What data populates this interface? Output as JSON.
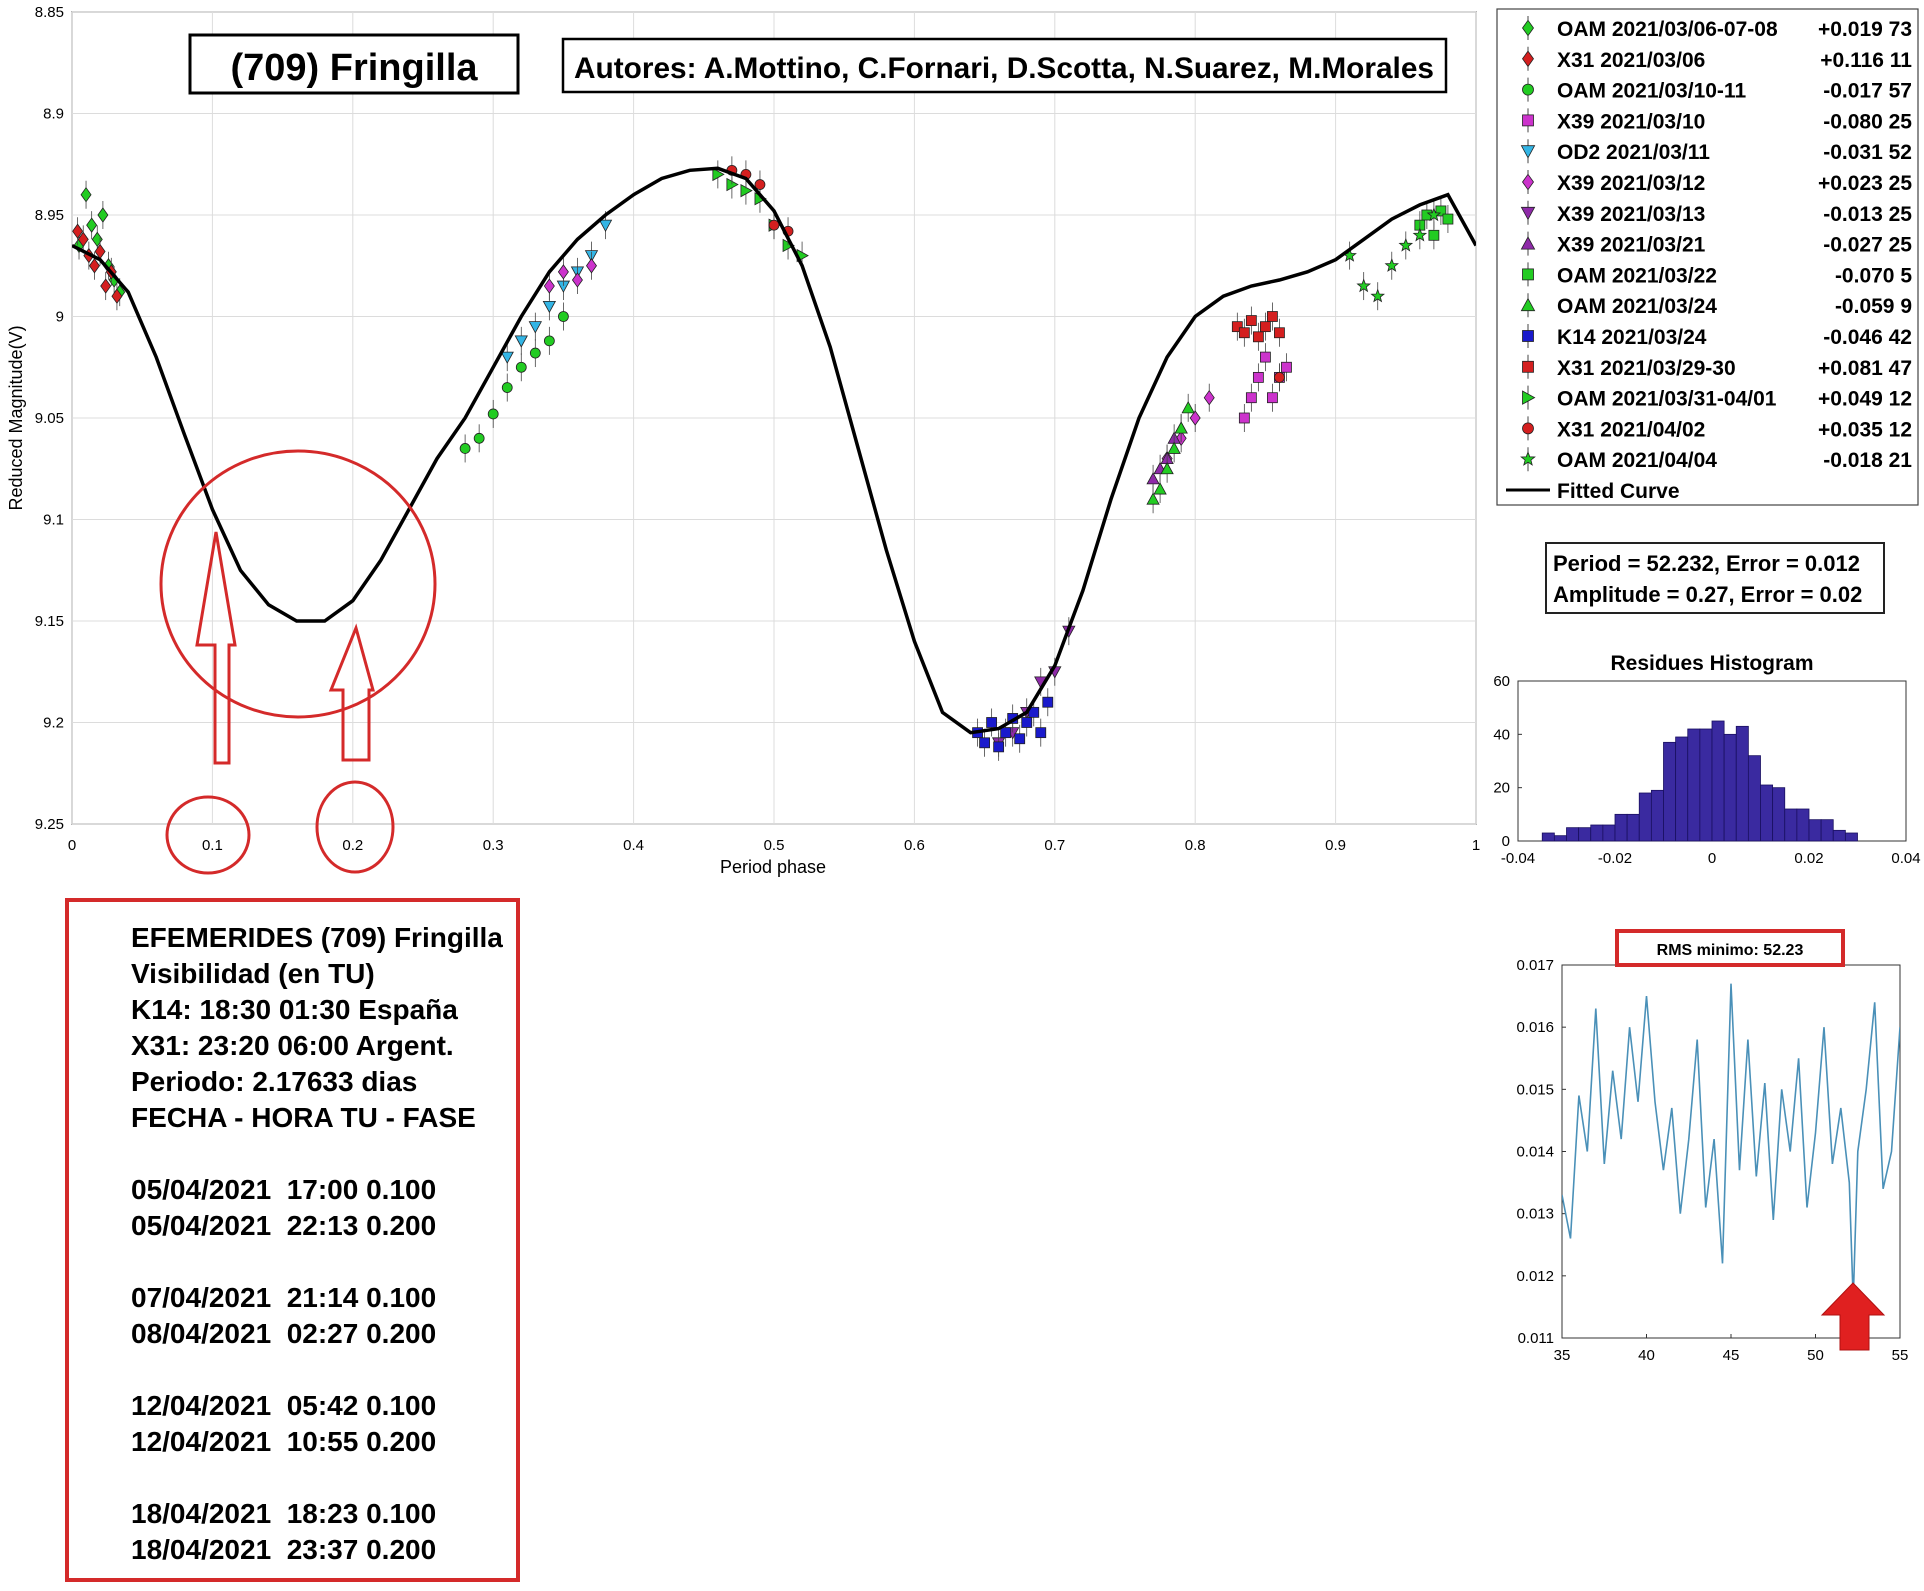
{
  "colors": {
    "green": "#22cc22",
    "red": "#d41f1f",
    "magenta": "#cc33cc",
    "purple": "#8e2aa8",
    "cyan": "#33b5e5",
    "blue": "#1a1acc",
    "annotation_red": "#d42a2a",
    "histogram_bar": "#3a2aa0",
    "rms_line": "#4a90b8"
  },
  "header": {
    "object_title": "(709) Fringilla",
    "authors": "Autores: A.Mottino, C.Fornari, D.Scotta, N.Suarez, M.Morales"
  },
  "stats": {
    "period_line": "Period =  52.232, Error = 0.012",
    "amplitude_line": "Amplitude = 0.27, Error = 0.02"
  },
  "legend": {
    "entries": [
      {
        "label": "OAM 2021/03/06-07-08",
        "value": "+0.019 73",
        "marker": "diamond",
        "color": "#22cc22"
      },
      {
        "label": "X31 2021/03/06",
        "value": "+0.116 11",
        "marker": "diamond",
        "color": "#d41f1f"
      },
      {
        "label": "OAM 2021/03/10-11",
        "value": "-0.017 57",
        "marker": "circle",
        "color": "#22cc22"
      },
      {
        "label": "X39 2021/03/10",
        "value": "-0.080 25",
        "marker": "square",
        "color": "#cc33cc"
      },
      {
        "label": "OD2 2021/03/11",
        "value": "-0.031 52",
        "marker": "triangle-down",
        "color": "#33b5e5"
      },
      {
        "label": "X39 2021/03/12",
        "value": "+0.023 25",
        "marker": "diamond",
        "color": "#cc33cc"
      },
      {
        "label": "X39 2021/03/13",
        "value": "-0.013 25",
        "marker": "triangle-down",
        "color": "#8e2aa8"
      },
      {
        "label": "X39 2021/03/21",
        "value": "-0.027 25",
        "marker": "triangle-up",
        "color": "#8e2aa8"
      },
      {
        "label": "OAM 2021/03/22",
        "value": "-0.070  5",
        "marker": "square",
        "color": "#22cc22"
      },
      {
        "label": "OAM 2021/03/24",
        "value": "-0.059  9",
        "marker": "triangle-up",
        "color": "#22cc22"
      },
      {
        "label": "K14 2021/03/24",
        "value": "-0.046 42",
        "marker": "square",
        "color": "#1a1acc"
      },
      {
        "label": "X31 2021/03/29-30",
        "value": "+0.081 47",
        "marker": "square",
        "color": "#d41f1f"
      },
      {
        "label": "OAM 2021/03/31-04/01",
        "value": "+0.049 12",
        "marker": "triangle-right",
        "color": "#22cc22"
      },
      {
        "label": "X31 2021/04/02",
        "value": "+0.035 12",
        "marker": "circle",
        "color": "#d41f1f"
      },
      {
        "label": "OAM 2021/04/04",
        "value": "-0.018 21",
        "marker": "star",
        "color": "#22cc22"
      },
      {
        "label": "Fitted Curve",
        "value": "",
        "marker": "line",
        "color": "#000000"
      }
    ]
  },
  "ephemeris": {
    "lines": [
      "EFEMERIDES (709) Fringilla",
      "Visibilidad (en TU)",
      "K14: 18:30 01:30 España",
      "X31: 23:20 06:00 Argent.",
      "Periodo: 2.17633 dias",
      "FECHA - HORA TU - FASE",
      "",
      "05/04/2021  17:00 0.100",
      "05/04/2021  22:13 0.200",
      "",
      "07/04/2021  21:14 0.100",
      "08/04/2021  02:27 0.200",
      "",
      "12/04/2021  05:42 0.100",
      "12/04/2021  10:55 0.200",
      "",
      "18/04/2021  18:23 0.100",
      "18/04/2021  23:37 0.200"
    ]
  },
  "rms_annotation": "RMS minimo: 52.23",
  "chart_data": [
    {
      "type": "scatter",
      "xlabel": "Period phase",
      "ylabel": "Reduced Magnitude(V)",
      "xlim": [
        0,
        1
      ],
      "ylim": [
        8.85,
        9.25
      ],
      "y_reversed": true,
      "xticks": [
        "0",
        "0.1",
        "0.2",
        "0.3",
        "0.4",
        "0.5",
        "0.6",
        "0.7",
        "0.8",
        "0.9",
        "1"
      ],
      "yticks": [
        "8.85",
        "8.9",
        "8.95",
        "9",
        "9.05",
        "9.1",
        "9.15",
        "9.2",
        "9.25"
      ],
      "grid": true,
      "legend_position": "right",
      "fitted_curve": {
        "name": "Fitted Curve",
        "x": [
          0,
          0.02,
          0.04,
          0.06,
          0.08,
          0.1,
          0.12,
          0.14,
          0.16,
          0.18,
          0.2,
          0.22,
          0.24,
          0.26,
          0.28,
          0.3,
          0.32,
          0.34,
          0.36,
          0.38,
          0.4,
          0.42,
          0.44,
          0.46,
          0.48,
          0.5,
          0.52,
          0.54,
          0.56,
          0.58,
          0.6,
          0.62,
          0.64,
          0.66,
          0.68,
          0.7,
          0.72,
          0.74,
          0.76,
          0.78,
          0.8,
          0.82,
          0.84,
          0.86,
          0.88,
          0.9,
          0.92,
          0.94,
          0.96,
          0.98,
          1.0
        ],
        "y": [
          8.965,
          8.972,
          8.988,
          9.02,
          9.058,
          9.095,
          9.125,
          9.142,
          9.15,
          9.15,
          9.14,
          9.12,
          9.095,
          9.07,
          9.05,
          9.025,
          9.0,
          8.978,
          8.962,
          8.95,
          8.94,
          8.932,
          8.928,
          8.927,
          8.932,
          8.948,
          8.975,
          9.015,
          9.065,
          9.115,
          9.16,
          9.195,
          9.205,
          9.203,
          9.195,
          9.172,
          9.135,
          9.09,
          9.05,
          9.02,
          9.0,
          8.99,
          8.985,
          8.982,
          8.978,
          8.972,
          8.962,
          8.952,
          8.945,
          8.94,
          8.965
        ]
      },
      "series": [
        {
          "name": "OAM 2021/03/06-07-08",
          "marker": "diamond",
          "color": "#22cc22",
          "x": [
            0.005,
            0.01,
            0.014,
            0.018,
            0.022,
            0.026,
            0.03,
            0.034
          ],
          "y": [
            8.965,
            8.94,
            8.955,
            8.962,
            8.95,
            8.975,
            8.982,
            8.988
          ]
        },
        {
          "name": "X31 2021/03/06",
          "marker": "diamond",
          "color": "#d41f1f",
          "x": [
            0.004,
            0.008,
            0.012,
            0.016,
            0.02,
            0.024,
            0.028,
            0.032
          ],
          "y": [
            8.958,
            8.962,
            8.97,
            8.975,
            8.968,
            8.985,
            8.978,
            8.99
          ]
        },
        {
          "name": "OAM 2021/03/10-11",
          "marker": "circle",
          "color": "#22cc22",
          "x": [
            0.28,
            0.29,
            0.3,
            0.31,
            0.32,
            0.33,
            0.34,
            0.35
          ],
          "y": [
            9.065,
            9.06,
            9.048,
            9.035,
            9.025,
            9.018,
            9.012,
            9.0
          ]
        },
        {
          "name": "X39 2021/03/10",
          "marker": "square",
          "color": "#cc33cc",
          "x": [
            0.835,
            0.84,
            0.845,
            0.85,
            0.855,
            0.86,
            0.865
          ],
          "y": [
            9.05,
            9.04,
            9.03,
            9.02,
            9.04,
            9.03,
            9.025
          ]
        },
        {
          "name": "OD2 2021/03/11",
          "marker": "triangle-down",
          "color": "#33b5e5",
          "x": [
            0.31,
            0.32,
            0.33,
            0.34,
            0.35,
            0.36,
            0.37,
            0.38
          ],
          "y": [
            9.02,
            9.012,
            9.005,
            8.995,
            8.985,
            8.978,
            8.97,
            8.955
          ]
        },
        {
          "name": "X39 2021/03/12",
          "marker": "diamond",
          "color": "#cc33cc",
          "x": [
            0.34,
            0.35,
            0.36,
            0.37,
            0.78,
            0.79,
            0.8,
            0.81
          ],
          "y": [
            8.985,
            8.978,
            8.982,
            8.975,
            9.07,
            9.06,
            9.05,
            9.04
          ]
        },
        {
          "name": "X39 2021/03/13",
          "marker": "triangle-down",
          "color": "#8e2aa8",
          "x": [
            0.66,
            0.67,
            0.68,
            0.69,
            0.7,
            0.71
          ],
          "y": [
            9.21,
            9.205,
            9.195,
            9.18,
            9.175,
            9.155
          ]
        },
        {
          "name": "X39 2021/03/21",
          "marker": "triangle-up",
          "color": "#8e2aa8",
          "x": [
            0.77,
            0.775,
            0.78,
            0.785,
            0.79
          ],
          "y": [
            9.08,
            9.075,
            9.07,
            9.06,
            9.055
          ]
        },
        {
          "name": "OAM 2021/03/22",
          "marker": "square",
          "color": "#22cc22",
          "x": [
            0.96,
            0.965,
            0.97,
            0.975,
            0.98
          ],
          "y": [
            8.955,
            8.95,
            8.96,
            8.948,
            8.952
          ]
        },
        {
          "name": "OAM 2021/03/24",
          "marker": "triangle-up",
          "color": "#22cc22",
          "x": [
            0.77,
            0.775,
            0.78,
            0.785,
            0.79,
            0.795
          ],
          "y": [
            9.09,
            9.085,
            9.075,
            9.065,
            9.055,
            9.045
          ]
        },
        {
          "name": "K14 2021/03/24",
          "marker": "square",
          "color": "#1a1acc",
          "x": [
            0.645,
            0.65,
            0.655,
            0.66,
            0.665,
            0.67,
            0.675,
            0.68,
            0.685,
            0.69,
            0.695
          ],
          "y": [
            9.205,
            9.21,
            9.2,
            9.212,
            9.205,
            9.198,
            9.208,
            9.2,
            9.195,
            9.205,
            9.19
          ]
        },
        {
          "name": "X31 2021/03/29-30",
          "marker": "square",
          "color": "#d41f1f",
          "x": [
            0.83,
            0.835,
            0.84,
            0.845,
            0.85,
            0.855,
            0.86
          ],
          "y": [
            9.005,
            9.008,
            9.002,
            9.01,
            9.005,
            9.0,
            9.008
          ]
        },
        {
          "name": "OAM 2021/03/31-04/01",
          "marker": "triangle-right",
          "color": "#22cc22",
          "x": [
            0.46,
            0.47,
            0.48,
            0.49,
            0.5,
            0.51,
            0.52
          ],
          "y": [
            8.93,
            8.935,
            8.938,
            8.942,
            8.955,
            8.965,
            8.97
          ]
        },
        {
          "name": "X31 2021/04/02",
          "marker": "circle",
          "color": "#d41f1f",
          "x": [
            0.47,
            0.48,
            0.49,
            0.5,
            0.51,
            0.86
          ],
          "y": [
            8.928,
            8.93,
            8.935,
            8.955,
            8.958,
            9.03
          ]
        },
        {
          "name": "OAM 2021/04/04",
          "marker": "star",
          "color": "#22cc22",
          "x": [
            0.91,
            0.92,
            0.93,
            0.94,
            0.95,
            0.96,
            0.97
          ],
          "y": [
            8.97,
            8.985,
            8.99,
            8.975,
            8.965,
            8.96,
            8.95
          ]
        }
      ]
    },
    {
      "type": "bar",
      "title": "Residues Histogram",
      "xlim": [
        -0.04,
        0.04
      ],
      "ylim": [
        0,
        60
      ],
      "xticks": [
        "-0.04",
        "-0.02",
        "0",
        "0.02",
        "0.04"
      ],
      "yticks": [
        "0",
        "20",
        "40",
        "60"
      ],
      "bin_width": 0.0025,
      "bin_centers": [
        -0.03375,
        -0.03125,
        -0.02875,
        -0.02625,
        -0.02375,
        -0.02125,
        -0.01875,
        -0.01625,
        -0.01375,
        -0.01125,
        -0.00875,
        -0.00625,
        -0.00375,
        -0.00125,
        0.00125,
        0.00375,
        0.00625,
        0.00875,
        0.01125,
        0.01375,
        0.01625,
        0.01875,
        0.02125,
        0.02375,
        0.02625,
        0.02875
      ],
      "values": [
        3,
        2,
        5,
        5,
        6,
        6,
        10,
        10,
        18,
        19,
        37,
        39,
        42,
        42,
        45,
        40,
        43,
        32,
        21,
        20,
        12,
        12,
        8,
        8,
        4,
        3
      ]
    },
    {
      "type": "line",
      "xlim": [
        35,
        55
      ],
      "ylim": [
        0.011,
        0.017
      ],
      "xticks": [
        "35",
        "40",
        "45",
        "50",
        "55"
      ],
      "yticks": [
        "0.011",
        "0.012",
        "0.013",
        "0.014",
        "0.015",
        "0.016",
        "0.017"
      ],
      "x": [
        35,
        35.5,
        36,
        36.5,
        37,
        37.5,
        38,
        38.5,
        39,
        39.5,
        40,
        40.5,
        41,
        41.5,
        42,
        42.5,
        43,
        43.5,
        44,
        44.5,
        45,
        45.5,
        46,
        46.5,
        47,
        47.5,
        48,
        48.5,
        49,
        49.5,
        50,
        50.5,
        51,
        51.5,
        52,
        52.23,
        52.5,
        53,
        53.5,
        54,
        54.5,
        55
      ],
      "y": [
        0.0133,
        0.0126,
        0.0149,
        0.014,
        0.0163,
        0.0138,
        0.0153,
        0.0142,
        0.016,
        0.0148,
        0.0165,
        0.0148,
        0.0137,
        0.0147,
        0.013,
        0.0142,
        0.0158,
        0.0131,
        0.0142,
        0.0122,
        0.0167,
        0.0137,
        0.0158,
        0.0136,
        0.0151,
        0.0129,
        0.015,
        0.014,
        0.0155,
        0.0131,
        0.0143,
        0.016,
        0.0138,
        0.0147,
        0.0135,
        0.0116,
        0.014,
        0.015,
        0.0164,
        0.0134,
        0.014,
        0.016
      ]
    }
  ]
}
